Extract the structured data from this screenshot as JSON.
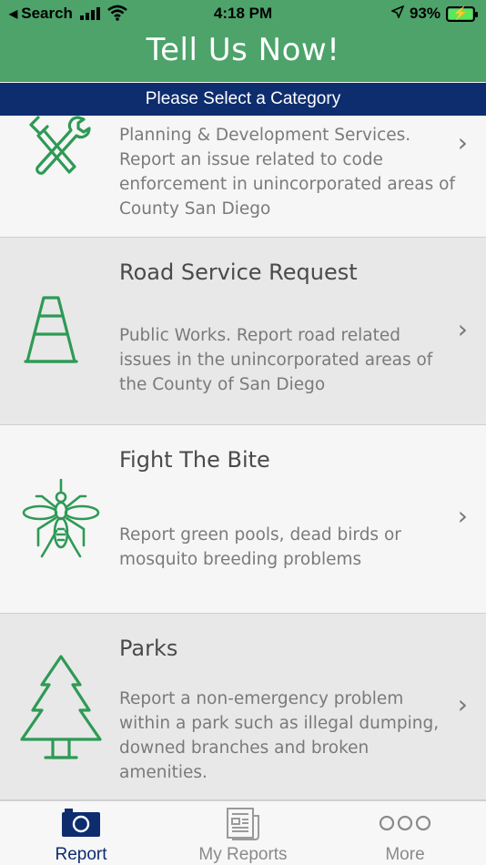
{
  "status_bar": {
    "back_label": "Search",
    "time": "4:18 PM",
    "battery": "93%",
    "battery_level": 0.93
  },
  "header": {
    "title": "Tell Us Now!",
    "subtitle": "Please Select a Category"
  },
  "categories": [
    {
      "title": "",
      "description": "Planning & Development Services. Report an issue related to code enforcement in unincorporated areas of County San Diego",
      "icon": "tools-icon"
    },
    {
      "title": "Road Service Request",
      "description": "Public Works. Report road related issues in the unincorporated areas of the County of San Diego",
      "icon": "traffic-cone-icon"
    },
    {
      "title": "Fight The Bite",
      "description": "Report green pools, dead birds or mosquito breeding problems",
      "icon": "mosquito-icon"
    },
    {
      "title": "Parks",
      "description": "Report a non-emergency problem within a park such as illegal dumping, downed branches and broken amenities.",
      "icon": "tree-icon"
    }
  ],
  "tabs": [
    {
      "label": "Report",
      "icon": "camera-icon",
      "active": true
    },
    {
      "label": "My Reports",
      "icon": "newspaper-icon",
      "active": false
    },
    {
      "label": "More",
      "icon": "more-dots-icon",
      "active": false
    }
  ],
  "colors": {
    "header_green": "#4da36a",
    "category_navy": "#0e2d6e",
    "icon_green": "#2e9a55"
  }
}
